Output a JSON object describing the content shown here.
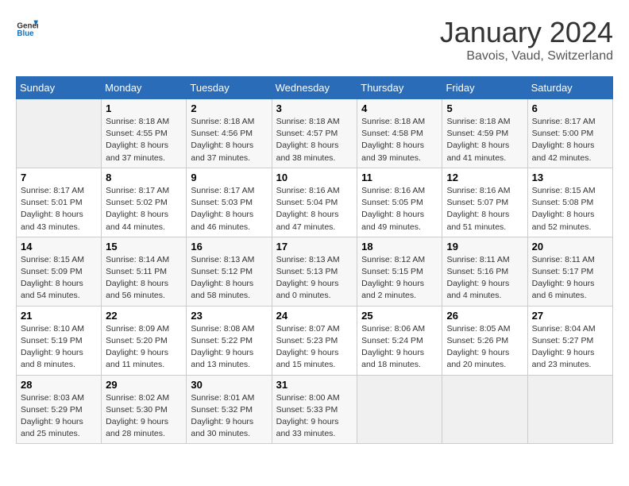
{
  "header": {
    "logo_line1": "General",
    "logo_line2": "Blue",
    "title": "January 2024",
    "subtitle": "Bavois, Vaud, Switzerland"
  },
  "weekdays": [
    "Sunday",
    "Monday",
    "Tuesday",
    "Wednesday",
    "Thursday",
    "Friday",
    "Saturday"
  ],
  "weeks": [
    [
      {
        "day": "",
        "info": ""
      },
      {
        "day": "1",
        "info": "Sunrise: 8:18 AM\nSunset: 4:55 PM\nDaylight: 8 hours\nand 37 minutes."
      },
      {
        "day": "2",
        "info": "Sunrise: 8:18 AM\nSunset: 4:56 PM\nDaylight: 8 hours\nand 37 minutes."
      },
      {
        "day": "3",
        "info": "Sunrise: 8:18 AM\nSunset: 4:57 PM\nDaylight: 8 hours\nand 38 minutes."
      },
      {
        "day": "4",
        "info": "Sunrise: 8:18 AM\nSunset: 4:58 PM\nDaylight: 8 hours\nand 39 minutes."
      },
      {
        "day": "5",
        "info": "Sunrise: 8:18 AM\nSunset: 4:59 PM\nDaylight: 8 hours\nand 41 minutes."
      },
      {
        "day": "6",
        "info": "Sunrise: 8:17 AM\nSunset: 5:00 PM\nDaylight: 8 hours\nand 42 minutes."
      }
    ],
    [
      {
        "day": "7",
        "info": "Sunrise: 8:17 AM\nSunset: 5:01 PM\nDaylight: 8 hours\nand 43 minutes."
      },
      {
        "day": "8",
        "info": "Sunrise: 8:17 AM\nSunset: 5:02 PM\nDaylight: 8 hours\nand 44 minutes."
      },
      {
        "day": "9",
        "info": "Sunrise: 8:17 AM\nSunset: 5:03 PM\nDaylight: 8 hours\nand 46 minutes."
      },
      {
        "day": "10",
        "info": "Sunrise: 8:16 AM\nSunset: 5:04 PM\nDaylight: 8 hours\nand 47 minutes."
      },
      {
        "day": "11",
        "info": "Sunrise: 8:16 AM\nSunset: 5:05 PM\nDaylight: 8 hours\nand 49 minutes."
      },
      {
        "day": "12",
        "info": "Sunrise: 8:16 AM\nSunset: 5:07 PM\nDaylight: 8 hours\nand 51 minutes."
      },
      {
        "day": "13",
        "info": "Sunrise: 8:15 AM\nSunset: 5:08 PM\nDaylight: 8 hours\nand 52 minutes."
      }
    ],
    [
      {
        "day": "14",
        "info": "Sunrise: 8:15 AM\nSunset: 5:09 PM\nDaylight: 8 hours\nand 54 minutes."
      },
      {
        "day": "15",
        "info": "Sunrise: 8:14 AM\nSunset: 5:11 PM\nDaylight: 8 hours\nand 56 minutes."
      },
      {
        "day": "16",
        "info": "Sunrise: 8:13 AM\nSunset: 5:12 PM\nDaylight: 8 hours\nand 58 minutes."
      },
      {
        "day": "17",
        "info": "Sunrise: 8:13 AM\nSunset: 5:13 PM\nDaylight: 9 hours\nand 0 minutes."
      },
      {
        "day": "18",
        "info": "Sunrise: 8:12 AM\nSunset: 5:15 PM\nDaylight: 9 hours\nand 2 minutes."
      },
      {
        "day": "19",
        "info": "Sunrise: 8:11 AM\nSunset: 5:16 PM\nDaylight: 9 hours\nand 4 minutes."
      },
      {
        "day": "20",
        "info": "Sunrise: 8:11 AM\nSunset: 5:17 PM\nDaylight: 9 hours\nand 6 minutes."
      }
    ],
    [
      {
        "day": "21",
        "info": "Sunrise: 8:10 AM\nSunset: 5:19 PM\nDaylight: 9 hours\nand 8 minutes."
      },
      {
        "day": "22",
        "info": "Sunrise: 8:09 AM\nSunset: 5:20 PM\nDaylight: 9 hours\nand 11 minutes."
      },
      {
        "day": "23",
        "info": "Sunrise: 8:08 AM\nSunset: 5:22 PM\nDaylight: 9 hours\nand 13 minutes."
      },
      {
        "day": "24",
        "info": "Sunrise: 8:07 AM\nSunset: 5:23 PM\nDaylight: 9 hours\nand 15 minutes."
      },
      {
        "day": "25",
        "info": "Sunrise: 8:06 AM\nSunset: 5:24 PM\nDaylight: 9 hours\nand 18 minutes."
      },
      {
        "day": "26",
        "info": "Sunrise: 8:05 AM\nSunset: 5:26 PM\nDaylight: 9 hours\nand 20 minutes."
      },
      {
        "day": "27",
        "info": "Sunrise: 8:04 AM\nSunset: 5:27 PM\nDaylight: 9 hours\nand 23 minutes."
      }
    ],
    [
      {
        "day": "28",
        "info": "Sunrise: 8:03 AM\nSunset: 5:29 PM\nDaylight: 9 hours\nand 25 minutes."
      },
      {
        "day": "29",
        "info": "Sunrise: 8:02 AM\nSunset: 5:30 PM\nDaylight: 9 hours\nand 28 minutes."
      },
      {
        "day": "30",
        "info": "Sunrise: 8:01 AM\nSunset: 5:32 PM\nDaylight: 9 hours\nand 30 minutes."
      },
      {
        "day": "31",
        "info": "Sunrise: 8:00 AM\nSunset: 5:33 PM\nDaylight: 9 hours\nand 33 minutes."
      },
      {
        "day": "",
        "info": ""
      },
      {
        "day": "",
        "info": ""
      },
      {
        "day": "",
        "info": ""
      }
    ]
  ]
}
